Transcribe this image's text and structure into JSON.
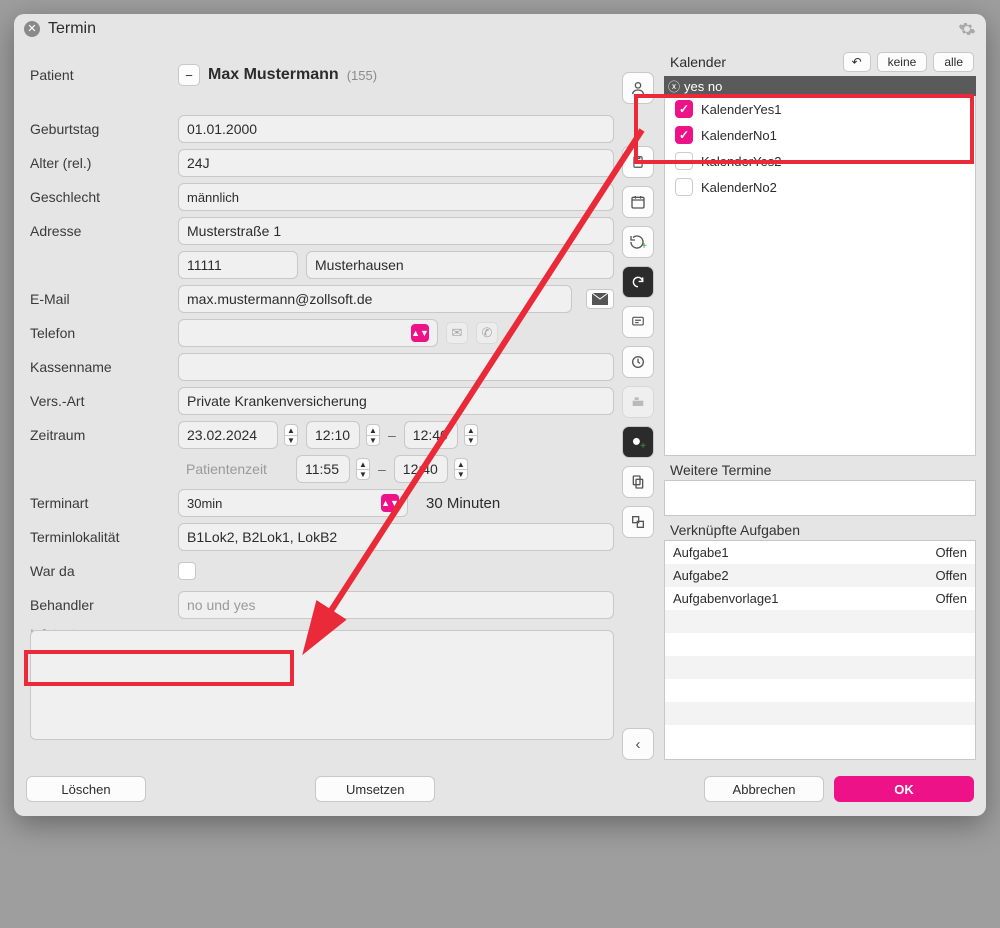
{
  "window": {
    "title": "Termin"
  },
  "labels": {
    "patient": "Patient",
    "birthday": "Geburtstag",
    "ageRel": "Alter (rel.)",
    "gender": "Geschlecht",
    "address": "Adresse",
    "email": "E-Mail",
    "phone": "Telefon",
    "insName": "Kassenname",
    "insType": "Vers.-Art",
    "period": "Zeitraum",
    "patientTime": "Patientenzeit",
    "apptKind": "Terminart",
    "apptLoc": "Terminlokalität",
    "wasThere": "War da",
    "practitioner": "Behandler",
    "infotext": "Infotext",
    "furtherAppts": "Weitere Termine",
    "linkedTasks": "Verknüpfte Aufgaben",
    "calendar": "Kalender",
    "none": "keine",
    "all": "alle",
    "search": "yes no"
  },
  "patient": {
    "name": "Max Mustermann",
    "id": "(155)",
    "birthday": "01.01.2000",
    "age": "24J",
    "gender": "männlich",
    "street": "Musterstraße 1",
    "zip": "11111",
    "city": "Musterhausen",
    "email": "max.mustermann@zollsoft.de",
    "phone": "",
    "insuranceName": "",
    "insuranceType": "Private Krankenversicherung"
  },
  "period": {
    "date": "23.02.2024",
    "from": "12:10",
    "to": "12:40",
    "patFrom": "11:55",
    "patTo": "12:40"
  },
  "appt": {
    "kind": "30min",
    "duration": "30 Minuten",
    "locality": "B1Lok2, B2Lok1, LokB2",
    "practitioner": "no und yes"
  },
  "calendars": [
    {
      "label": "KalenderYes1",
      "checked": true
    },
    {
      "label": "KalenderNo1",
      "checked": true
    },
    {
      "label": "KalenderYes2",
      "checked": false
    },
    {
      "label": "KalenderNo2",
      "checked": false
    }
  ],
  "tasks": [
    {
      "name": "Aufgabe1",
      "status": "Offen"
    },
    {
      "name": "Aufgabe2",
      "status": "Offen"
    },
    {
      "name": "Aufgabenvorlage1",
      "status": "Offen"
    }
  ],
  "footer": {
    "delete": "Löschen",
    "move": "Umsetzen",
    "cancel": "Abbrechen",
    "ok": "OK"
  }
}
